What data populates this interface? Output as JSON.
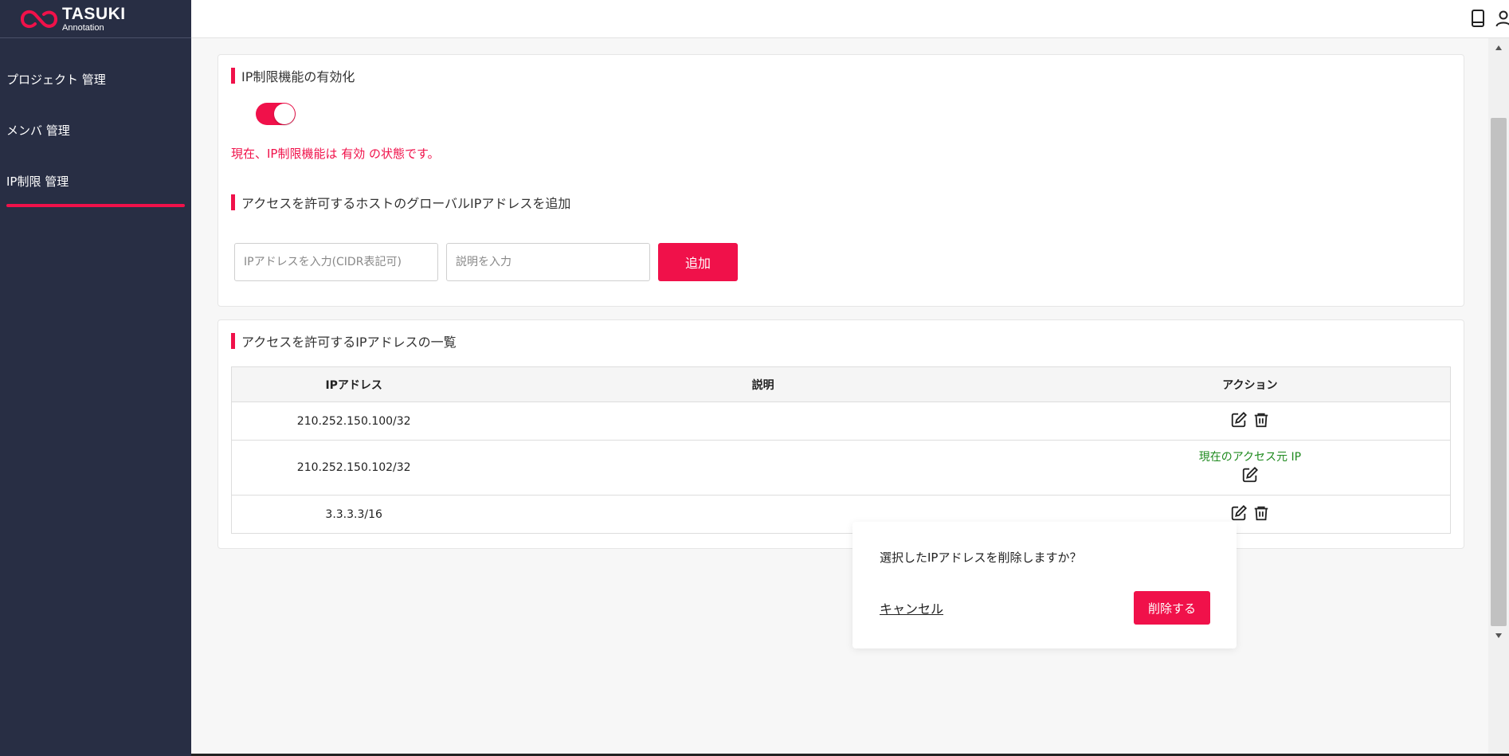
{
  "app": {
    "logo_main": "TASUKI",
    "logo_sub": "Annotation",
    "brand_color": "#f0114a"
  },
  "sidebar": {
    "items": [
      {
        "label": "プロジェクト 管理",
        "active": false
      },
      {
        "label": "メンバ 管理",
        "active": false
      },
      {
        "label": "IP制限 管理",
        "active": true
      }
    ]
  },
  "header": {
    "icons": [
      "book-icon",
      "user-icon"
    ]
  },
  "ip_restriction": {
    "title": "IP制限機能の有効化",
    "enabled": true,
    "status_text": "現在、IP制限機能は 有効 の状態です。"
  },
  "add_ip": {
    "title": "アクセスを許可するホストのグローバルIPアドレスを追加",
    "ip_placeholder": "IPアドレスを入力(CIDR表記可)",
    "ip_value": "",
    "desc_placeholder": "説明を入力",
    "desc_value": "",
    "add_label": "追加"
  },
  "ip_list": {
    "title": "アクセスを許可するIPアドレスの一覧",
    "columns": [
      "IPアドレス",
      "説明",
      "アクション"
    ],
    "rows": [
      {
        "ip": "210.252.150.100/32",
        "description": "",
        "current": false,
        "actions": [
          "edit-icon",
          "trash-icon"
        ]
      },
      {
        "ip": "210.252.150.102/32",
        "description": "",
        "current": true,
        "current_label": "現在のアクセス元 IP",
        "actions": [
          "edit-icon"
        ]
      },
      {
        "ip": "3.3.3.3/16",
        "description": "",
        "current": false,
        "actions": [
          "edit-icon",
          "trash-icon"
        ]
      }
    ]
  },
  "delete_popover": {
    "message": "選択したIPアドレスを削除しますか？",
    "cancel_label": "キャンセル",
    "delete_label": "削除する"
  }
}
